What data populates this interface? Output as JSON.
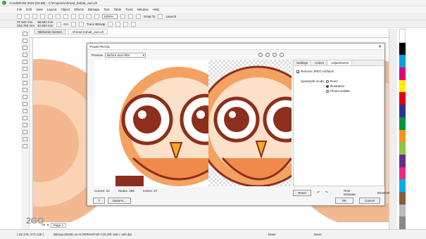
{
  "window": {
    "title": "CorelDRAW 2019 (64-Bit) - C:\\Projects\\Ahmad_Zahab_owl.cdr"
  },
  "menu": [
    "File",
    "Edit",
    "View",
    "Layout",
    "Object",
    "Effects",
    "Bitmaps",
    "Text",
    "Table",
    "Tools",
    "Window",
    "Help"
  ],
  "toolbar": {
    "zoom": "1000%",
    "snap": "Snap To",
    "launch": "Launch"
  },
  "propbar": {
    "x": "37.542 mm",
    "y": "254.783 mm",
    "w": "38.852 mm",
    "h": "42.503 mm",
    "angle": "0.0",
    "trace": "Trace Bitmap"
  },
  "tabs": [
    "Welcome Screen",
    "Ahmad Zahab_owl.cdr"
  ],
  "dialog": {
    "title": "PowerTRACE",
    "preview_label": "Preview",
    "preview_mode": "Before and After",
    "stats": {
      "curves": "Curves:  34",
      "nodes": "Nodes:  456",
      "colors": "Colors:  27"
    },
    "options_button": "Options...",
    "settings_tabs": [
      "Settings",
      "Colors",
      "Adjustments"
    ],
    "remove_jpeg": "Remove JPEG Artifacts",
    "upsample_label": "Upsample mode:",
    "upsample_options": [
      "None",
      "Illustration",
      "Photo-realistic"
    ],
    "reset": "Reset",
    "time_estimate": "Time estimate:",
    "time": "00:00:00",
    "ok": "OK",
    "cancel": "Cancel"
  },
  "pagebar": {
    "page": "Page 1"
  },
  "status": {
    "coords": "( 33.175, 273.128 )",
    "info": "Bitmap (RGB) on ALTERNATIVE COLOR 150 x 150 dpi",
    "fill": "None",
    "outline": "None"
  },
  "watermark": "2GO",
  "colors": {
    "owl_orange": "#f4a261",
    "owl_dark": "#8c2f1c",
    "owl_light": "#fde0c8",
    "canvas_owl": "#f3b88f"
  }
}
